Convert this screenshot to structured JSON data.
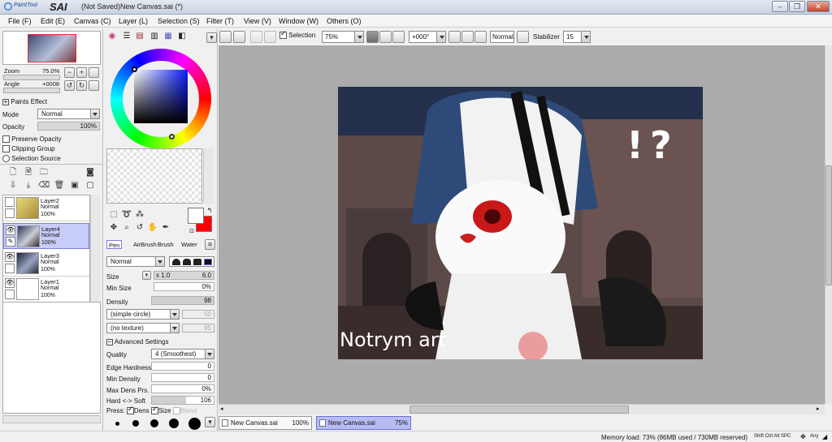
{
  "window": {
    "app_logo_small": "PaintTool",
    "app_logo": "SAI",
    "title": "(Not Saved)New Canvas.sai (*)",
    "minimize": "–",
    "maximize": "❐",
    "close": "✕"
  },
  "menu": [
    "File (F)",
    "Edit (E)",
    "Canvas (C)",
    "Layer (L)",
    "Selection (S)",
    "Filter (T)",
    "View (V)",
    "Window (W)",
    "Others (O)"
  ],
  "toolbar": {
    "selection_label": "Selection",
    "selection_checked": true,
    "zoom": "75%",
    "rotation": "+000°",
    "blend_mode": "Normal",
    "stabilizer_label": "Stabilizer",
    "stabilizer": "15"
  },
  "navigator": {
    "zoom_label": "Zoom",
    "zoom_value": "75.0%",
    "angle_label": "Angle",
    "angle_value": "+0008"
  },
  "layer_props": {
    "paints_effect": "Paints Effect",
    "mode_label": "Mode",
    "mode_value": "Normal",
    "opacity_label": "Opacity",
    "opacity_value": "100%",
    "preserve_opacity": "Preserve Opacity",
    "clipping_group": "Clipping Group",
    "selection_source": "Selection Source"
  },
  "layers": [
    {
      "name": "Layer2",
      "mode": "Normal",
      "opacity": "100%",
      "visible": false,
      "selected": false
    },
    {
      "name": "Layer4",
      "mode": "Normal",
      "opacity": "100%",
      "visible": true,
      "selected": true
    },
    {
      "name": "Layer3",
      "mode": "Normal",
      "opacity": "100%",
      "visible": true,
      "selected": false
    },
    {
      "name": "Layer1",
      "mode": "Normal",
      "opacity": "100%",
      "visible": true,
      "selected": false
    }
  ],
  "brush_tabs": [
    "Pen",
    "AirBrush",
    "Brush",
    "Water"
  ],
  "brush": {
    "mode": "Normal",
    "size_label": "Size",
    "size_mult": "x 1.0",
    "size_value": "6.0",
    "min_size_label": "Min Size",
    "min_size_value": "0%",
    "density_label": "Density",
    "density_value": "98",
    "shape": "(simple circle)",
    "shape_value": "50",
    "texture": "(no texture)",
    "texture_value": "95",
    "advanced": "Advanced Settings",
    "quality_label": "Quality",
    "quality_value": "4 (Smoothest)",
    "edge_hardness_label": "Edge Hardness",
    "edge_hardness_value": "0",
    "min_density_label": "Min Density",
    "min_density_value": "0",
    "max_dens_label": "Max Dens Prs.",
    "max_dens_value": "0%",
    "hard_soft_label": "Hard <-> Soft",
    "hard_soft_value": "106",
    "press_label": "Press:",
    "dens_label": "Dens",
    "size2_label": "Size",
    "blend_label": "Blend"
  },
  "colors": {
    "primary": "#ffffff",
    "secondary": "#ff0000",
    "accent_select": "#c8ccf8"
  },
  "artwork": {
    "text_overlay": "!?",
    "signature": "Notrym art"
  },
  "tabs": [
    {
      "name": "New Canvas.sai",
      "zoom": "100%",
      "active": false
    },
    {
      "name": "New Canvas.sai",
      "zoom": "75%",
      "active": true
    }
  ],
  "status": {
    "memory": "Memory load: 73% (86MB used / 730MB reserved)",
    "keys": "Shift Ctrl Alt SPC",
    "any": "Any"
  }
}
